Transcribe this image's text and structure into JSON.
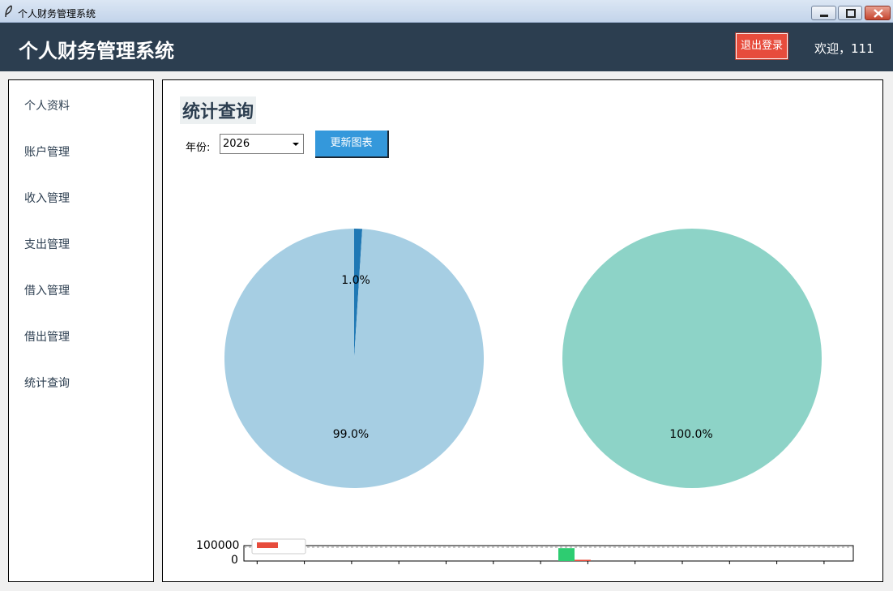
{
  "window": {
    "title": "个人财务管理系统"
  },
  "header": {
    "app_title": "个人财务管理系统",
    "logout_label": "退出登录",
    "welcome_text": "欢迎，111"
  },
  "sidebar": {
    "items": [
      {
        "label": "个人资料"
      },
      {
        "label": "账户管理"
      },
      {
        "label": "收入管理"
      },
      {
        "label": "支出管理"
      },
      {
        "label": "借入管理"
      },
      {
        "label": "借出管理"
      },
      {
        "label": "统计查询"
      }
    ]
  },
  "main": {
    "title": "统计查询",
    "year_label": "年份:",
    "year_value": "2026",
    "update_label": "更新图表"
  },
  "chart_data": [
    {
      "type": "pie",
      "title": "",
      "slices": [
        {
          "label": "",
          "value": 1.0,
          "pct_label": "1.0%",
          "color": "#1f78b4"
        },
        {
          "label": "",
          "value": 99.0,
          "pct_label": "99.0%",
          "color": "#a6cee3"
        }
      ]
    },
    {
      "type": "pie",
      "title": "",
      "slices": [
        {
          "label": "",
          "value": 100.0,
          "pct_label": "100.0%",
          "color": "#8dd3c7"
        }
      ]
    },
    {
      "type": "bar",
      "yticks": [
        "100000",
        "0"
      ],
      "ylim": [
        0,
        120000
      ],
      "legend": [
        {
          "label": "",
          "color": "#e74c3c"
        }
      ],
      "series": [
        {
          "color": "#2ecc71",
          "values": [
            0,
            0,
            0,
            0,
            0,
            0,
            0,
            100000,
            0,
            0,
            0,
            0,
            0
          ]
        },
        {
          "color": "#e74c3c",
          "values": [
            0,
            0,
            0,
            0,
            0,
            0,
            0,
            1000,
            0,
            0,
            0,
            0,
            0
          ]
        }
      ]
    }
  ]
}
